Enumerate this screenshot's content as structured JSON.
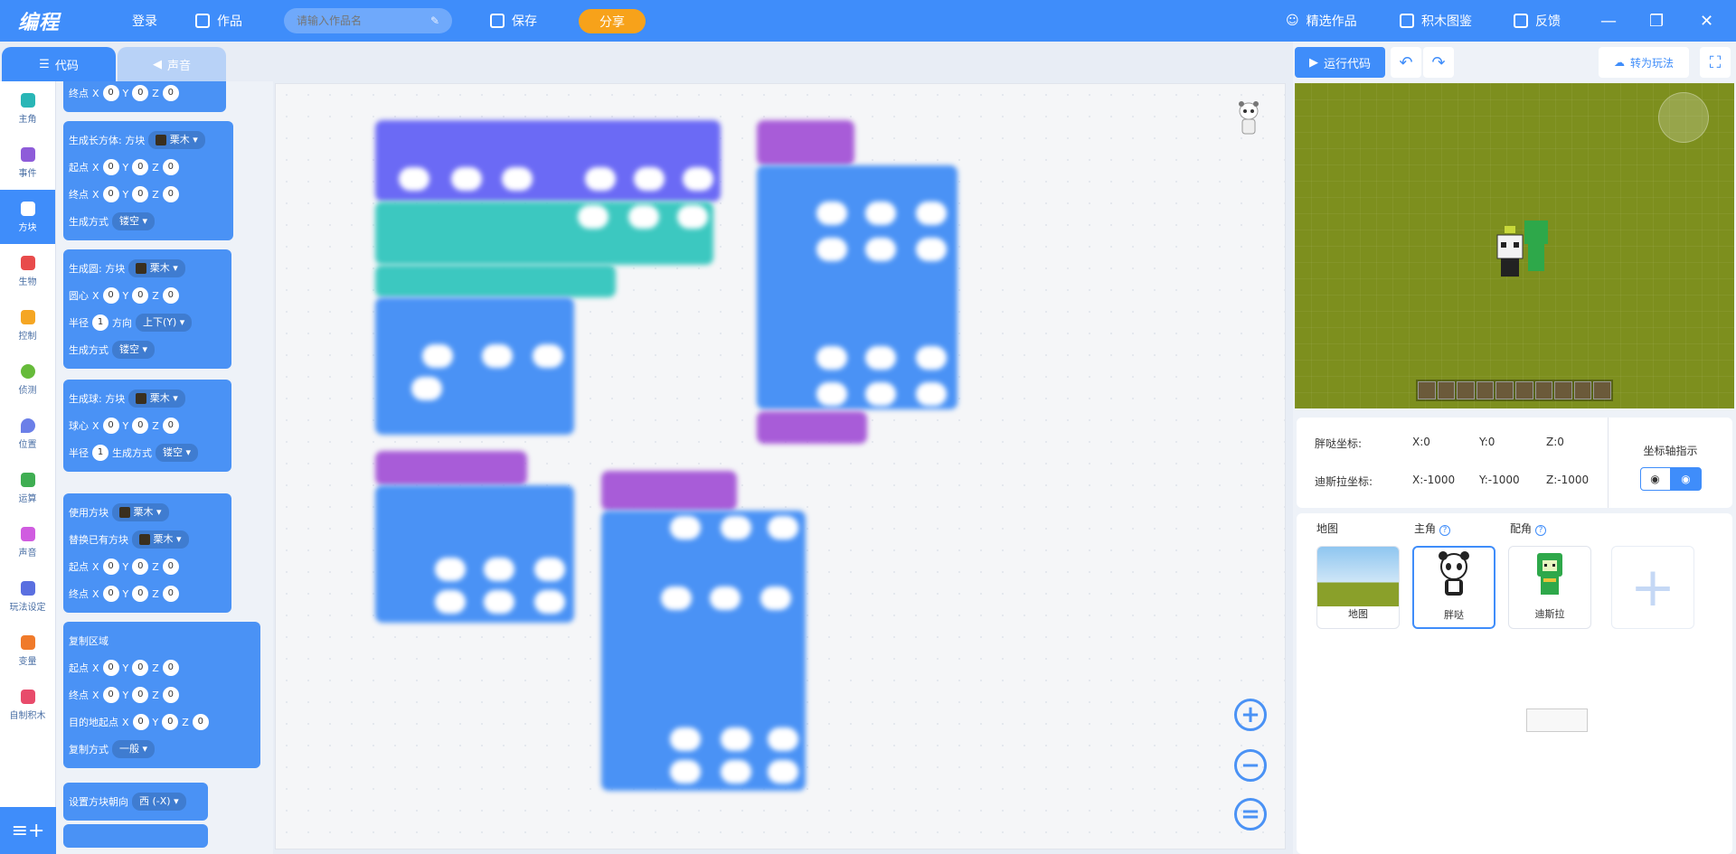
{
  "header": {
    "logo": "编程",
    "login": "登录",
    "works": "作品",
    "title_placeholder": "请输入作品名",
    "save": "保存",
    "share": "分享",
    "featured": "精选作品",
    "blocks_catalog": "积木图鉴",
    "feedback": "反馈"
  },
  "tabs": {
    "code": "代码",
    "sound": "声音"
  },
  "categories": [
    {
      "label": "主角",
      "color": "#29b6b6"
    },
    {
      "label": "事件",
      "color": "#8e5cd9"
    },
    {
      "label": "方块",
      "color": "#4a92f5"
    },
    {
      "label": "生物",
      "color": "#e84b4b"
    },
    {
      "label": "控制",
      "color": "#f5a623"
    },
    {
      "label": "侦测",
      "color": "#66bb3a"
    },
    {
      "label": "位置",
      "color": "#6b7fe8"
    },
    {
      "label": "运算",
      "color": "#3fae52"
    },
    {
      "label": "声音",
      "color": "#d05ce0"
    },
    {
      "label": "玩法设定",
      "color": "#5a6fe0"
    },
    {
      "label": "变量",
      "color": "#f07a2a"
    },
    {
      "label": "自制积木",
      "color": "#e84b6b"
    }
  ],
  "palette": {
    "end": "终点",
    "x": "X",
    "y": "Y",
    "z": "Z",
    "zero": "0",
    "one": "1",
    "gen_cuboid": "生成长方体: 方块",
    "wood": "栗木",
    "start": "起点",
    "gen_mode": "生成方式",
    "hollow": "镂空",
    "gen_circle": "生成圆: 方块",
    "center": "圆心",
    "radius": "半径",
    "direction": "方向",
    "updown": "上下(Y)",
    "gen_sphere": "生成球: 方块",
    "sphere_center": "球心",
    "use_block": "使用方块",
    "replace": "替换已有方块",
    "copy_area": "复制区域",
    "target_start": "目的地起点",
    "copy_mode": "复制方式",
    "normal": "一般",
    "set_facing": "设置方块朝向",
    "west": "西 (-X)"
  },
  "right": {
    "run": "运行代码",
    "to_play": "转为玩法",
    "panda_coord": "胖哒坐标:",
    "panda_x": "X:0",
    "panda_y": "Y:0",
    "panda_z": "Z:0",
    "dila_coord": "迪斯拉坐标:",
    "dila_x": "X:-1000",
    "dila_y": "Y:-1000",
    "dila_z": "Z:-1000",
    "axis_hint": "坐标轴指示",
    "map": "地图",
    "hero": "主角",
    "partner": "配角",
    "card_map": "地图",
    "card_hero": "胖哒",
    "card_partner": "迪斯拉"
  }
}
